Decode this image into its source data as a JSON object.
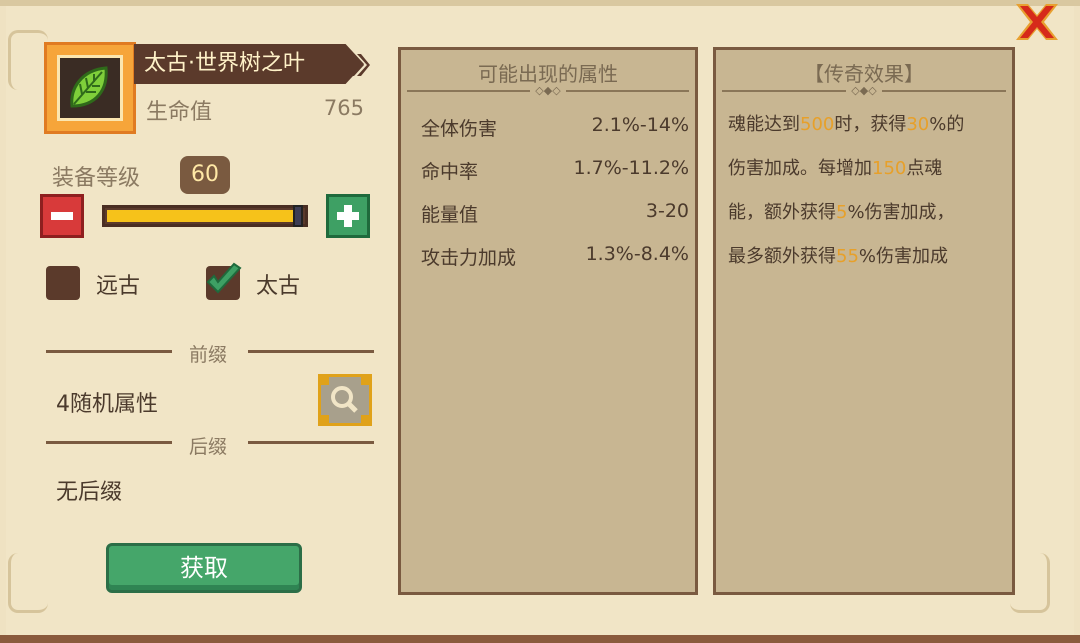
{
  "item": {
    "name": "太古·世界树之叶",
    "hp_label": "生命值",
    "hp_value": "765"
  },
  "level": {
    "label": "装备等级",
    "value": "60",
    "slider_fraction": 1.0
  },
  "tiers": [
    {
      "label": "远古",
      "checked": false
    },
    {
      "label": "太古",
      "checked": true
    }
  ],
  "prefix": {
    "title": "前缀",
    "text": "4随机属性"
  },
  "suffix": {
    "title": "后缀",
    "text": "无后缀"
  },
  "get_button": "获取",
  "attributes_panel": {
    "title": "可能出现的属性",
    "rows": [
      {
        "name": "全体伤害",
        "value": "2.1%-14%"
      },
      {
        "name": "命中率",
        "value": "1.7%-11.2%"
      },
      {
        "name": "能量值",
        "value": "3-20"
      },
      {
        "name": "攻击力加成",
        "value": "1.3%-8.4%"
      }
    ]
  },
  "legend_panel": {
    "title": "【传奇效果】",
    "lines": [
      [
        {
          "t": "魂能达到",
          "h": false
        },
        {
          "t": "500",
          "h": true
        },
        {
          "t": "时，获得",
          "h": false
        },
        {
          "t": "30",
          "h": true
        },
        {
          "t": "%的",
          "h": false
        }
      ],
      [
        {
          "t": "伤害加成。每增加",
          "h": false
        },
        {
          "t": "150",
          "h": true
        },
        {
          "t": "点魂",
          "h": false
        }
      ],
      [
        {
          "t": "能，额外获得",
          "h": false
        },
        {
          "t": "5",
          "h": true
        },
        {
          "t": "%伤害加成，",
          "h": false
        }
      ],
      [
        {
          "t": "最多额外获得",
          "h": false
        },
        {
          "t": "55",
          "h": true
        },
        {
          "t": "%伤害加成",
          "h": false
        }
      ]
    ]
  },
  "colors": {
    "highlight": "#e7a02a",
    "background": "#f1e5c6",
    "panel": "#c8b692"
  }
}
